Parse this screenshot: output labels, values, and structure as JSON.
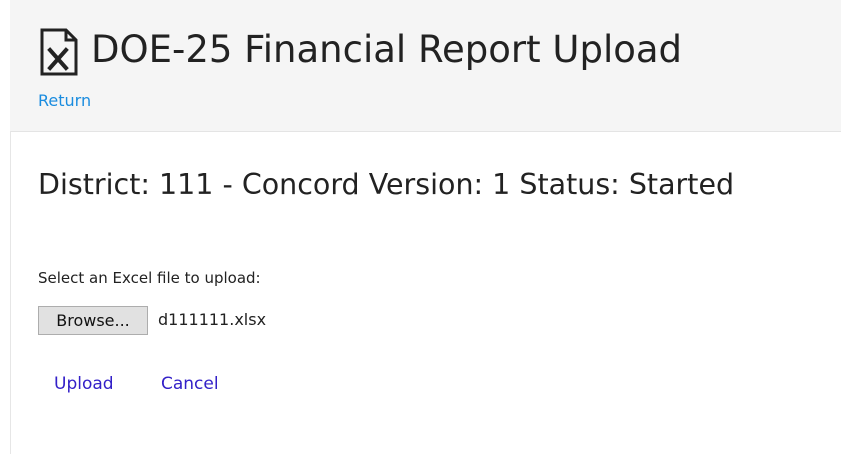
{
  "header": {
    "title": "DOE-25 Financial Report Upload",
    "icon": "excel-file-icon",
    "return_label": "Return"
  },
  "status": {
    "heading": "District: 111 - Concord Version: 1 Status: Started"
  },
  "upload_form": {
    "select_label": "Select an Excel file to upload:",
    "browse_label": "Browse...",
    "selected_file": "d111111.xlsx",
    "upload_label": "Upload",
    "cancel_label": "Cancel"
  },
  "colors": {
    "header_background": "#f5f5f5",
    "return_link": "#1a8cdf",
    "action_link": "#3320c8",
    "text": "#222222"
  }
}
